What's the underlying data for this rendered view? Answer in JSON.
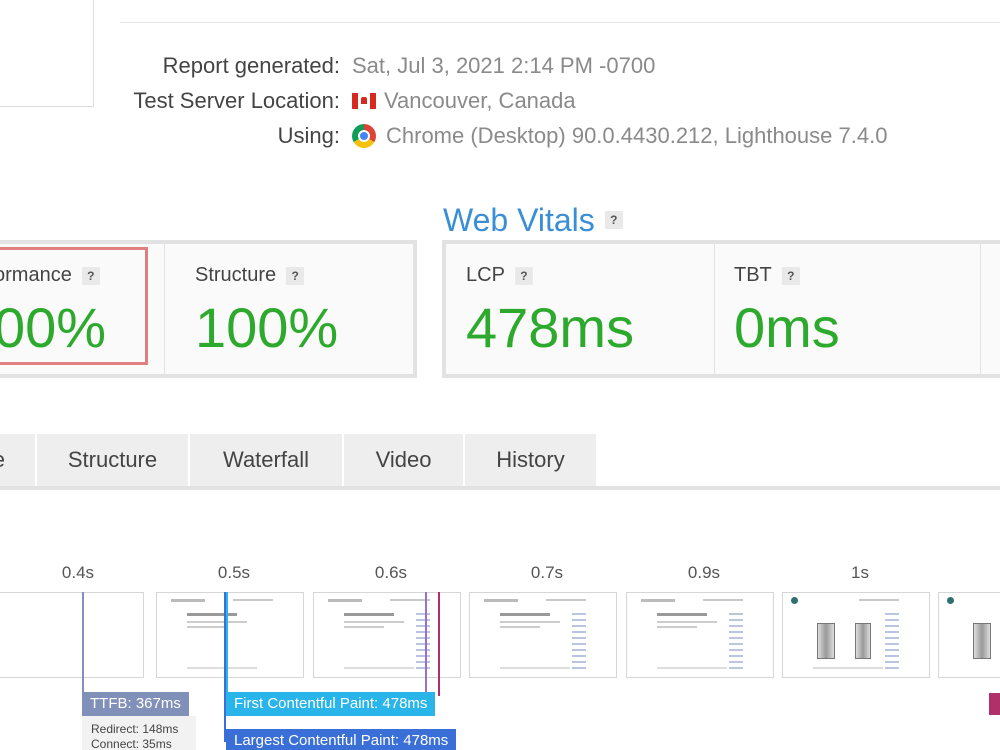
{
  "report": {
    "rows": [
      {
        "label": "Report generated:",
        "value": "Sat, Jul 3, 2021 2:14 PM -0700"
      },
      {
        "label": "Test Server Location:",
        "value": "Vancouver, Canada"
      },
      {
        "label": "Using:",
        "value": "Chrome (Desktop) 90.0.4430.212, Lighthouse 7.4.0"
      }
    ]
  },
  "web_vitals": {
    "heading": "Web Vitals",
    "help": "?"
  },
  "scores": {
    "performance": {
      "title": "ormance",
      "value": "00%"
    },
    "structure": {
      "title": "Structure",
      "value": "100%"
    },
    "lcp": {
      "title": "LCP",
      "value": "478ms"
    },
    "tbt": {
      "title": "TBT",
      "value": "0ms"
    }
  },
  "tabs": [
    {
      "label": "e"
    },
    {
      "label": "Structure"
    },
    {
      "label": "Waterfall"
    },
    {
      "label": "Video"
    },
    {
      "label": "History"
    }
  ],
  "filmstrip": {
    "times": [
      "0.4s",
      "0.5s",
      "0.6s",
      "0.7s",
      "0.9s",
      "1s"
    ]
  },
  "markers": {
    "ttfb": "TTFB: 367ms",
    "fcp": "First Contentful Paint: 478ms",
    "lcp": "Largest Contentful Paint: 478ms",
    "redirect": "Redirect: 148ms",
    "connect": "Connect: 35ms"
  },
  "colors": {
    "good": "#2daa2d",
    "accent": "#3a8ed6",
    "ttfb": "#8090b8",
    "fcp": "#29b4ea",
    "lcp": "#3a6fd8",
    "highlight": "#e07f80"
  }
}
